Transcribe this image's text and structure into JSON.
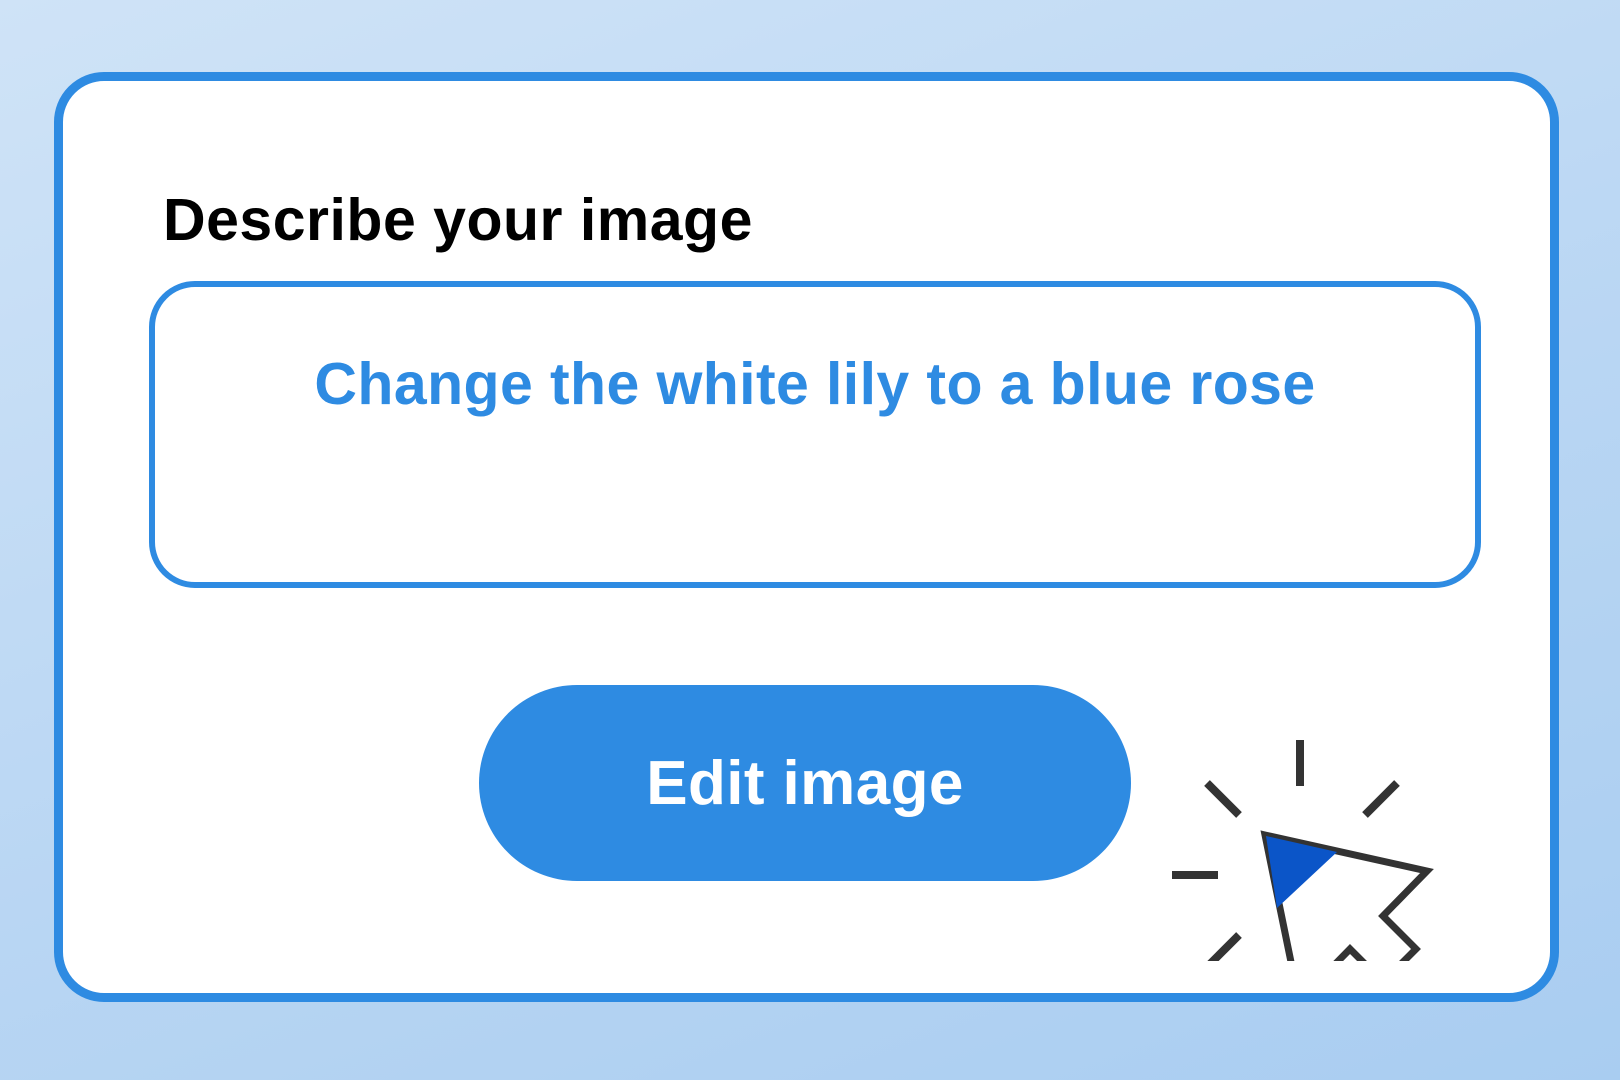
{
  "form": {
    "heading": "Describe your image",
    "prompt_value": "Change the white lily to a blue rose",
    "submit_label": "Edit image"
  },
  "icons": {
    "cursor": "click-cursor-icon"
  },
  "colors": {
    "accent": "#2e8be2",
    "cursor_fill": "#0b55c8",
    "cursor_outline": "#333333",
    "background": "#bcd8f3"
  }
}
